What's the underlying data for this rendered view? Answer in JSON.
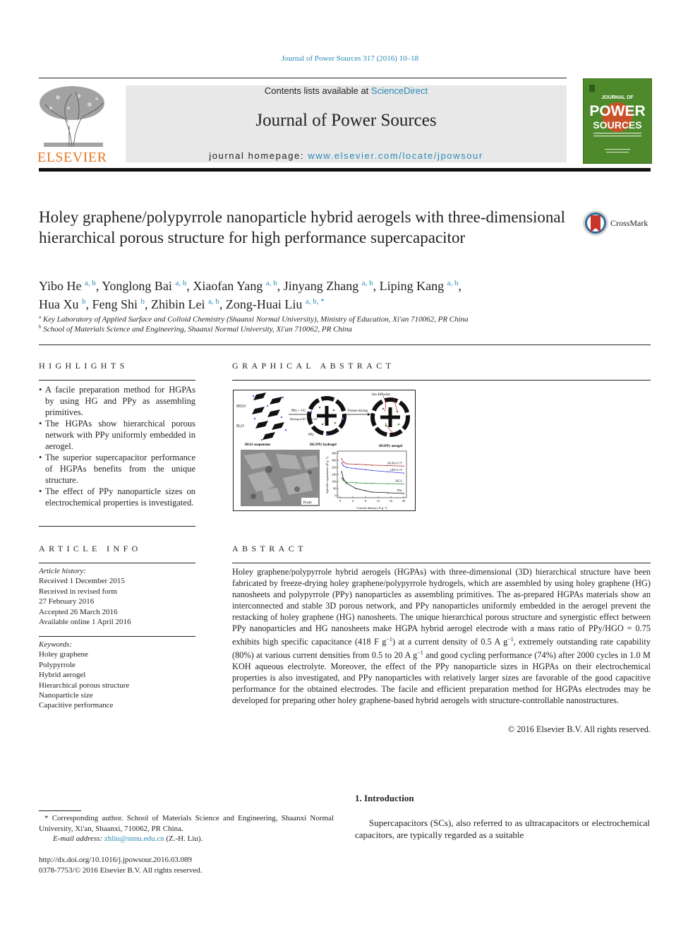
{
  "header": {
    "citation": "Journal of Power Sources 317 (2016) 10–18",
    "contents_prefix": "Contents lists available at ",
    "contents_link": "ScienceDirect",
    "journal_title": "Journal of Power Sources",
    "homepage_prefix": "journal homepage: ",
    "homepage_link": "www.elsevier.com/locate/jpowsour",
    "publisher_logo": "ELSEVIER",
    "cover": {
      "line1": "JOURNAL OF",
      "line2": "POWER",
      "line3": "SOURCES",
      "bg_color": "#4e8a2c",
      "accent_color": "#c9512a"
    }
  },
  "article": {
    "title": "Holey graphene/polypyrrole nanoparticle hybrid aerogels with three-dimensional hierarchical porous structure for high performance supercapacitor",
    "crossmark_label": "CrossMark",
    "authors": [
      {
        "name": "Yibo He",
        "aff": "a, b"
      },
      {
        "name": "Yonglong Bai",
        "aff": "a, b"
      },
      {
        "name": "Xiaofan Yang",
        "aff": "a, b"
      },
      {
        "name": "Jinyang Zhang",
        "aff": "a, b"
      },
      {
        "name": "Liping Kang",
        "aff": "a, b"
      },
      {
        "name": "Hua Xu",
        "aff": "b"
      },
      {
        "name": "Feng Shi",
        "aff": "b"
      },
      {
        "name": "Zhibin Lei",
        "aff": "a, b"
      },
      {
        "name": "Zong-Huai Liu",
        "aff": "a, b, *"
      }
    ],
    "affiliations": [
      {
        "mark": "a",
        "text": "Key Laboratory of Applied Surface and Colloid Chemistry (Shaanxi Normal University), Ministry of Education, Xi'an 710062, PR China"
      },
      {
        "mark": "b",
        "text": "School of Materials Science and Engineering, Shaanxi Normal University, Xi'an 710062, PR China"
      }
    ]
  },
  "highlights": {
    "heading": "HIGHLIGHTS",
    "items": [
      "A facile preparation method for HGPAs by using HG and PPy as assembling primitives.",
      "The HGPAs show hierarchical porous network with PPy uniformly embedded in aerogel.",
      "The superior supercapacitor performance of HGPAs benefits from the unique structure.",
      "The effect of PPy nanoparticle sizes on electrochemical properties is investigated."
    ]
  },
  "graphical_abstract": {
    "heading": "GRAPHICAL ABSTRACT",
    "labels": {
      "hgo": "HGO",
      "h2o": "H₂O",
      "step1": "PPy + VC",
      "step1b": "Heating at 80 °C for 8 h",
      "step2": "Freeze-drying",
      "ion": "Ion diffusion",
      "ppy": "PPy",
      "stage1": "HGO suspension",
      "stage2": "HG/PPy hydrogel",
      "stage3": "HGPPy aerogel",
      "scale": "10 μm"
    },
    "chart_data": {
      "type": "line",
      "title": "",
      "xlabel": "Current density (A g⁻¹)",
      "ylabel": "Specific capacitance (F g⁻¹)",
      "xlim": [
        0,
        20
      ],
      "ylim": [
        0,
        480
      ],
      "xticks": [
        "0",
        "4",
        "8",
        "12",
        "16",
        "20"
      ],
      "yticks": [
        "0",
        "80",
        "160",
        "240",
        "320",
        "400",
        "480"
      ],
      "x": [
        0.5,
        1,
        2,
        5,
        8,
        10,
        15,
        20
      ],
      "series": [
        {
          "name": "HGPA-0.75",
          "color": "#b02a2a",
          "values": [
            418,
            380,
            360,
            355,
            350,
            345,
            340,
            334
          ]
        },
        {
          "name": "GPA-0.75",
          "color": "#3a3ae8",
          "values": [
            370,
            340,
            320,
            305,
            295,
            285,
            270,
            255
          ]
        },
        {
          "name": "HGA",
          "color": "#2f8a2f",
          "values": [
            200,
            170,
            150,
            145,
            140,
            138,
            135,
            132
          ]
        },
        {
          "name": "PPy",
          "color": "#111111",
          "values": [
            270,
            190,
            140,
            80,
            55,
            40,
            32,
            25
          ]
        }
      ]
    }
  },
  "article_info": {
    "heading": "ARTICLE INFO",
    "history_label": "Article history:",
    "history": [
      "Received 1 December 2015",
      "Received in revised form",
      "27 February 2016",
      "Accepted 26 March 2016",
      "Available online 1 April 2016"
    ],
    "keywords_label": "Keywords:",
    "keywords": [
      "Holey graphene",
      "Polypyrrole",
      "Hybrid aerogel",
      "Hierarchical porous structure",
      "Nanoparticle size",
      "Capacitive performance"
    ]
  },
  "abstract": {
    "heading": "ABSTRACT",
    "p1": "Holey graphene/polypyrrole hybrid aerogels (HGPAs) with three-dimensional (3D) hierarchical structure have been fabricated by freeze-drying holey graphene/polypyrrole hydrogels, which are assembled by using holey graphene (HG) nanosheets and polypyrrole (PPy) nanoparticles as assembling primitives. The as-prepared HGPAs materials show an interconnected and stable 3D porous network, and PPy nanoparticles uniformly embedded in the aerogel prevent the restacking of holey graphene (HG) nanosheets. The unique hierarchical porous structure and synergistic effect between PPy nanoparticles and HG nanosheets make HGPA hybrid aerogel electrode with a mass ratio of PPy/HGO = 0.75 exhibits high specific capacitance (418 F g",
    "sup1": "−1",
    "p2": ") at a current density of 0.5 A g",
    "sup2": "−1",
    "p3": ", extremely outstanding rate capability (80%) at various current densities from 0.5 to 20 A g",
    "sup3": "−1",
    "p4": " and good cycling performance (74%) after 2000 cycles in 1.0 M KOH aqueous electrolyte. Moreover, the effect of the PPy nanoparticle sizes in HGPAs on their electrochemical properties is also investigated, and PPy nanoparticles with relatively larger sizes are favorable of the good capacitive performance for the obtained electrodes. The facile and efficient preparation method for HGPAs electrodes may be developed for preparing other holey graphene-based hybrid aerogels with structure-controllable nanostructures.",
    "copyright": "© 2016 Elsevier B.V. All rights reserved."
  },
  "footnotes": {
    "corresponding": "* Corresponding author. School of Materials Science and Engineering, Shaanxi Normal University, Xi'an, Shaanxi, 710062, PR China.",
    "email_label": "E-mail address: ",
    "email": "zhliu@snnu.edu.cn",
    "email_suffix": " (Z.-H. Liu).",
    "doi": "http://dx.doi.org/10.1016/j.jpowsour.2016.03.089",
    "issn": "0378-7753/© 2016 Elsevier B.V. All rights reserved."
  },
  "introduction": {
    "heading": "1.  Introduction",
    "text": "Supercapacitors (SCs), also referred to as ultracapacitors or electrochemical capacitors, are typically regarded as a suitable"
  }
}
